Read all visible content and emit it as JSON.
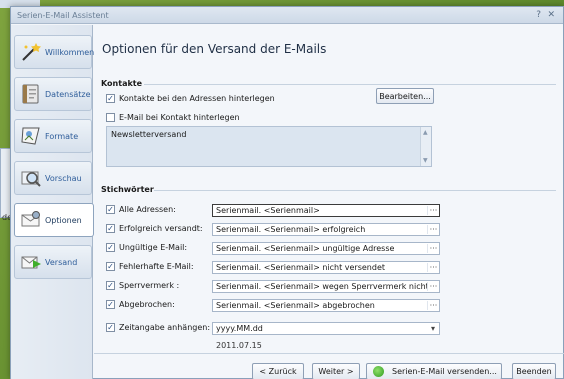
{
  "window": {
    "title": "Serien-E-Mail Assistent",
    "help": "?",
    "close": "✕"
  },
  "background_fragment": "de",
  "sidebar": {
    "items": [
      {
        "label": "Willkommen",
        "icon": "magic-wand-icon",
        "active": false
      },
      {
        "label": "Datensätze",
        "icon": "address-book-icon",
        "active": false
      },
      {
        "label": "Formate",
        "icon": "format-document-icon",
        "active": false
      },
      {
        "label": "Vorschau",
        "icon": "magnifier-icon",
        "active": false
      },
      {
        "label": "Optionen",
        "icon": "options-envelope-icon",
        "active": true
      },
      {
        "label": "Versand",
        "icon": "send-envelope-icon",
        "active": false
      }
    ]
  },
  "main": {
    "title": "Optionen für den Versand der E-Mails",
    "contacts": {
      "heading": "Kontakte",
      "store_contacts_label": "Kontakte bei den Adressen hinterlegen",
      "store_contacts_checked": true,
      "edit_button": "Bearbeiten...",
      "email_contact_label": "E-Mail bei Kontakt hinterlegen",
      "email_contact_checked": false,
      "textarea_value": "Newsletterversand"
    },
    "keywords": {
      "heading": "Stichwörter",
      "rows": [
        {
          "label": "Alle Adressen:",
          "checked": true,
          "value": "Serienmail. <Serienmail>"
        },
        {
          "label": "Erfolgreich versandt:",
          "checked": true,
          "value": "Serienmail. <Serienmail> erfolgreich"
        },
        {
          "label": "Ungültige E-Mail:",
          "checked": true,
          "value": "Serienmail. <Serienmail> ungültige Adresse"
        },
        {
          "label": "Fehlerhafte E-Mail:",
          "checked": true,
          "value": "Serienmail. <Serienmail> nicht versendet"
        },
        {
          "label": "Sperrvermerk :",
          "checked": true,
          "value": "Serienmail. <Serienmail> wegen Sperrvermerk nicht v..."
        },
        {
          "label": "Abgebrochen:",
          "checked": true,
          "value": "Serienmail. <Serienmail> abgebrochen"
        }
      ],
      "time_label": "Zeitangabe  anhängen:",
      "time_checked": true,
      "time_format": "yyyy.MM.dd",
      "time_preview": "2011.07.15"
    }
  },
  "footer": {
    "back": "< Zurück",
    "next": "Weiter >",
    "send": "Serien-E-Mail versenden...",
    "finish": "Beenden"
  },
  "symbols": {
    "check": "✓",
    "ellipsis": "···",
    "dropdown": "▾",
    "up": "▲",
    "down": "▼"
  }
}
